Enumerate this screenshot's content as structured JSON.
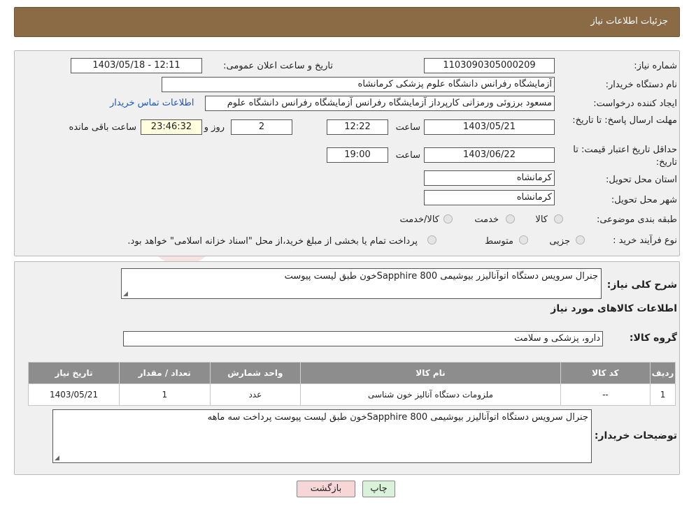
{
  "header": {
    "title": "جزئیات اطلاعات نیاز"
  },
  "need": {
    "number_label": "شماره نیاز:",
    "number": "1103090305000209",
    "announce_label": "تاریخ و ساعت اعلان عمومی:",
    "announce_value": "1403/05/18 - 12:11",
    "buyer_label": "نام دستگاه خریدار:",
    "buyer": "آزمایشگاه رفرانس دانشگاه علوم پزشکی کرمانشاه",
    "creator_label": "ایجاد کننده درخواست:",
    "creator": "مسعود برزوئی ورمزانی کارپرداز آزمایشگاه رفرانس آزمایشگاه رفرانس دانشگاه علوم",
    "contact_link": "اطلاعات تماس خریدار",
    "deadline_label": "مهلت ارسال پاسخ: تا تاریخ:",
    "deadline_date": "1403/05/21",
    "time_label": "ساعت",
    "deadline_time": "12:22",
    "days_value": "2",
    "days_label": "روز و",
    "remaining_time": "23:46:32",
    "remaining_label": "ساعت باقی مانده",
    "validity_label": "حداقل تاریخ اعتبار قیمت: تا تاریخ:",
    "validity_date": "1403/06/22",
    "validity_time_label": "ساعت",
    "validity_time": "19:00",
    "province_label": "استان محل تحویل:",
    "province": "کرمانشاه",
    "city_label": "شهر محل تحویل:",
    "city": "کرمانشاه",
    "category_label": "طبقه بندی موضوعی:",
    "category_options": [
      "کالا",
      "خدمت",
      "کالا/خدمت"
    ],
    "process_label": "نوع فرآیند خرید :",
    "process_options": [
      "جزیی",
      "متوسط"
    ],
    "process_note": "پرداخت تمام یا بخشی از مبلغ خرید،از محل \"اسناد خزانه اسلامی\" خواهد بود."
  },
  "details": {
    "summary_label": "شرح کلی نیاز:",
    "summary": "جنرال سرویس دستگاه اتوآنالیزر بیوشیمی Sapphire 800خون طبق لیست پیوست",
    "goods_heading": "اطلاعات کالاهای مورد نیاز",
    "group_label": "گروه کالا:",
    "group": "دارو، پزشکی و سلامت",
    "table": {
      "headers": [
        "ردیف",
        "کد کالا",
        "نام کالا",
        "واحد شمارش",
        "تعداد / مقدار",
        "تاریخ نیاز"
      ],
      "rows": [
        [
          "1",
          "--",
          "ملزومات دستگاه آنالیز خون شناسی",
          "عدد",
          "1",
          "1403/05/21"
        ]
      ]
    },
    "buyer_notes_label": "توضیحات خریدار:",
    "buyer_notes": "جنرال سرویس دستگاه اتوآنالیزر بیوشیمی Sapphire 800خون طبق لیست پیوست پرداخت سه ماهه"
  },
  "buttons": {
    "print": "چاپ",
    "back": "بازگشت"
  },
  "watermark": {
    "text": "AriaTender.neT"
  },
  "colors": {
    "header": "#8b6b45",
    "table_header": "#8d8d8d",
    "link": "#1a55c9",
    "back_button": "#f6d6d6",
    "print_button": "#d9f2d9"
  }
}
